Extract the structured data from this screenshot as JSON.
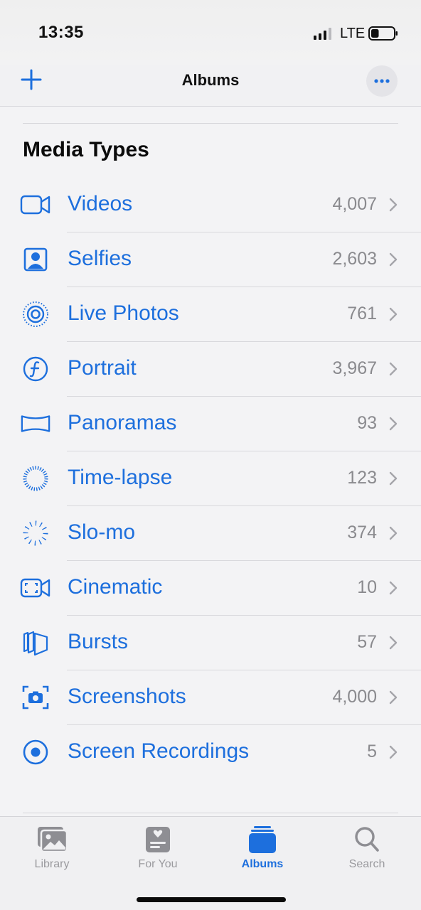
{
  "status_bar": {
    "time": "13:35",
    "network": "LTE",
    "battery_level": 0.35
  },
  "nav": {
    "title": "Albums",
    "add_icon": "plus-icon",
    "more_icon": "ellipsis-icon"
  },
  "section": {
    "title": "Media Types"
  },
  "media_types": [
    {
      "label": "Videos",
      "count": "4,007",
      "icon": "video-icon"
    },
    {
      "label": "Selfies",
      "count": "2,603",
      "icon": "selfie-icon"
    },
    {
      "label": "Live Photos",
      "count": "761",
      "icon": "live-photo-icon"
    },
    {
      "label": "Portrait",
      "count": "3,967",
      "icon": "portrait-icon"
    },
    {
      "label": "Panoramas",
      "count": "93",
      "icon": "panorama-icon"
    },
    {
      "label": "Time-lapse",
      "count": "123",
      "icon": "timelapse-icon"
    },
    {
      "label": "Slo-mo",
      "count": "374",
      "icon": "slomo-icon"
    },
    {
      "label": "Cinematic",
      "count": "10",
      "icon": "cinematic-icon"
    },
    {
      "label": "Bursts",
      "count": "57",
      "icon": "bursts-icon"
    },
    {
      "label": "Screenshots",
      "count": "4,000",
      "icon": "screenshot-icon"
    },
    {
      "label": "Screen Recordings",
      "count": "5",
      "icon": "screen-recording-icon"
    }
  ],
  "tabs": [
    {
      "label": "Library",
      "icon": "library-icon",
      "active": false
    },
    {
      "label": "For You",
      "icon": "for-you-icon",
      "active": false
    },
    {
      "label": "Albums",
      "icon": "albums-icon",
      "active": true
    },
    {
      "label": "Search",
      "icon": "search-icon",
      "active": false
    }
  ],
  "colors": {
    "accent": "#1d6fdd",
    "secondary_text": "#8a8a8e",
    "inactive_tab": "#9a9a9e"
  }
}
